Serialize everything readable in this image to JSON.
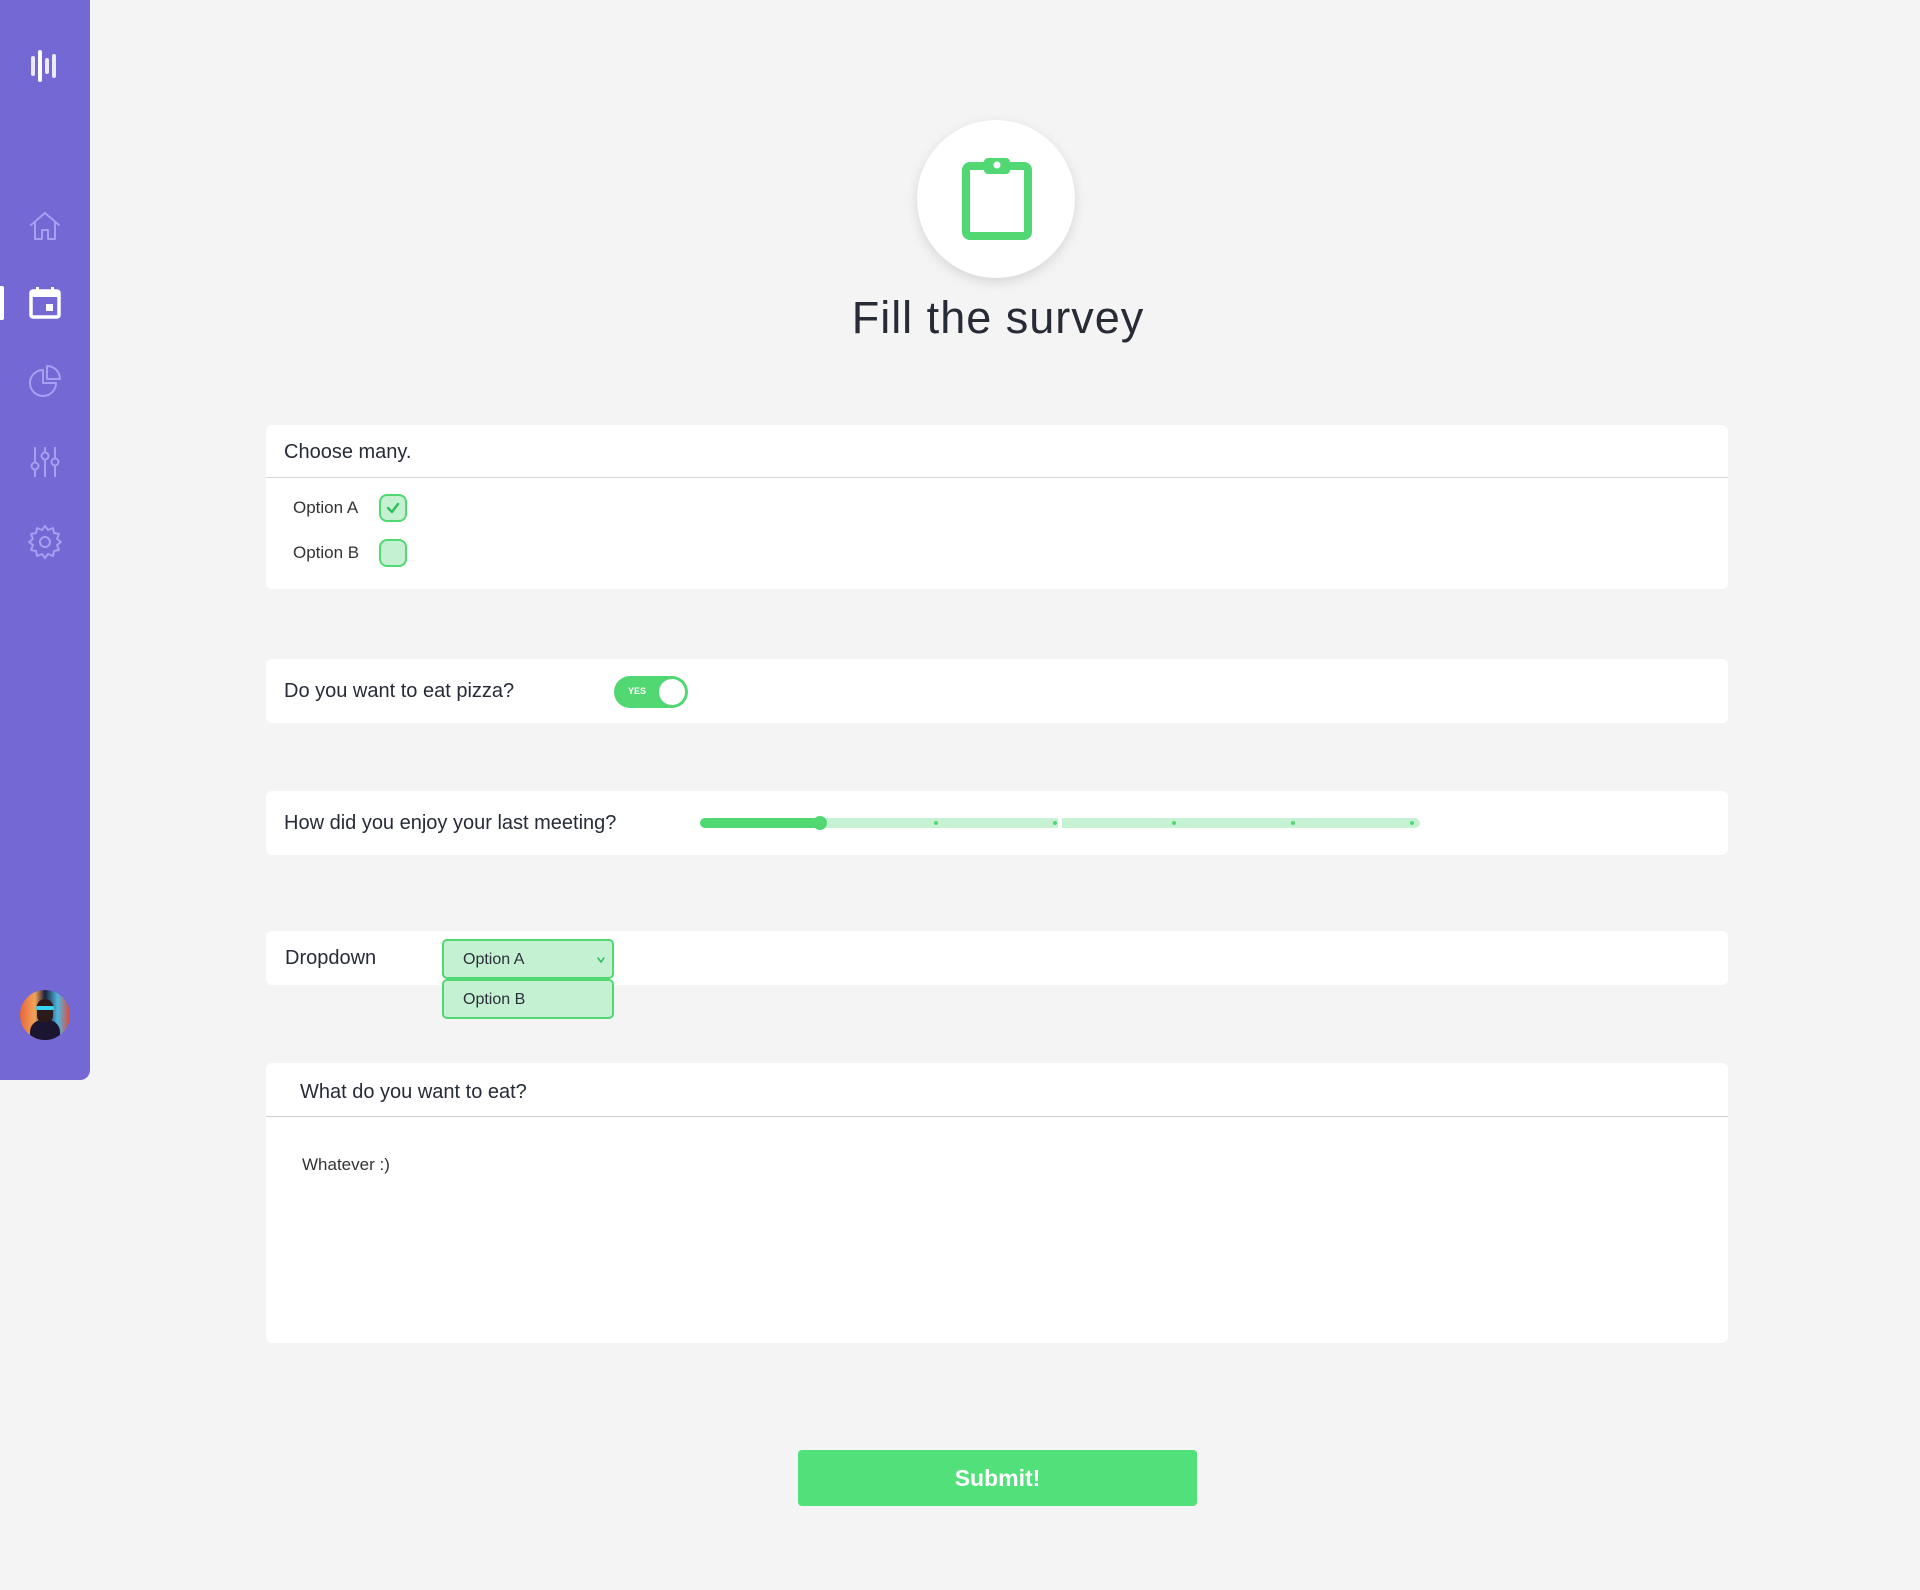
{
  "app": {
    "accent_color": "#52d873",
    "sidebar_color": "#7468d4"
  },
  "sidebar": {
    "logo_icon": "bars-logo-icon",
    "items": [
      {
        "icon": "home-icon",
        "active": false
      },
      {
        "icon": "calendar-icon",
        "active": true
      },
      {
        "icon": "pie-chart-icon",
        "active": false
      },
      {
        "icon": "sliders-icon",
        "active": false
      },
      {
        "icon": "gear-icon",
        "active": false
      }
    ],
    "avatar_icon": "user-avatar"
  },
  "header": {
    "icon": "clipboard-icon",
    "title": "Fill the survey"
  },
  "survey": {
    "multi_choice": {
      "question": "Choose many.",
      "options": [
        {
          "label": "Option A",
          "checked": true
        },
        {
          "label": "Option B",
          "checked": false
        }
      ]
    },
    "toggle_question": {
      "question": "Do you want to eat pizza?",
      "toggle_label": "YES",
      "value": true
    },
    "rating_question": {
      "question": "How did you enjoy your last meeting?",
      "value_fraction": 0.167,
      "steps": 6
    },
    "dropdown": {
      "label": "Dropdown",
      "selected": "Option A",
      "options": [
        "Option A",
        "Option B"
      ]
    },
    "text_question": {
      "question": "What do you want to eat?",
      "answer": "Whatever :)"
    },
    "submit_label": "Submit!"
  }
}
